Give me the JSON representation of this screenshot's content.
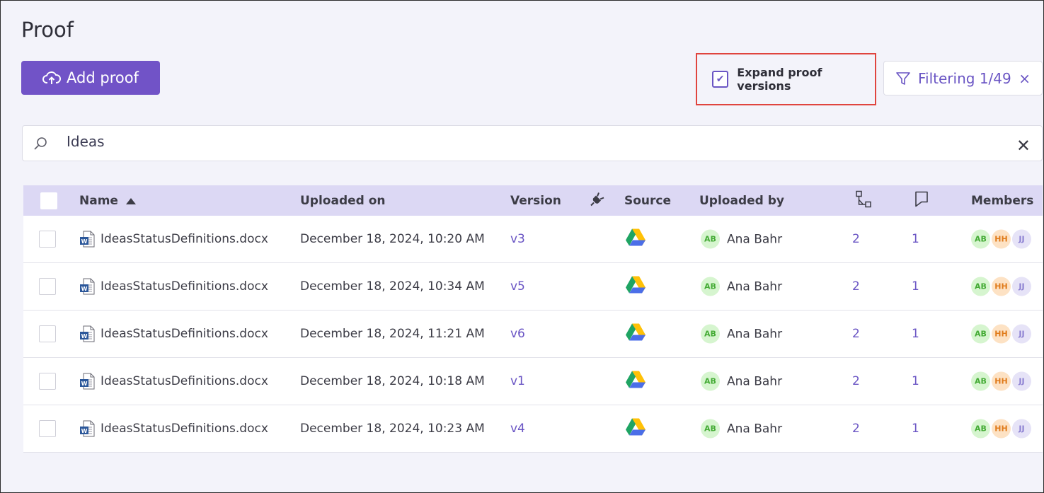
{
  "page": {
    "title": "Proof"
  },
  "toolbar": {
    "add_label": "Add proof",
    "expand_label": "Expand proof versions",
    "expand_checked": true,
    "filter_label": "Filtering 1/49"
  },
  "search": {
    "value": "Ideas"
  },
  "table": {
    "headers": {
      "name": "Name",
      "uploaded_on": "Uploaded on",
      "version": "Version",
      "source": "Source",
      "uploaded_by": "Uploaded by",
      "members": "Members"
    },
    "sort": {
      "column": "name",
      "direction": "ascending"
    },
    "rows": [
      {
        "name": "IdeasStatusDefinitions.docx",
        "uploaded_on": "December 18, 2024, 10:20 AM",
        "version": "v3",
        "uploader_initials": "AB",
        "uploader": "Ana Bahr",
        "workflow_count": "2",
        "comments_count": "1",
        "members": [
          "AB",
          "HH",
          "JJ"
        ]
      },
      {
        "name": "IdeasStatusDefinitions.docx",
        "uploaded_on": "December 18, 2024, 10:34 AM",
        "version": "v5",
        "uploader_initials": "AB",
        "uploader": "Ana Bahr",
        "workflow_count": "2",
        "comments_count": "1",
        "members": [
          "AB",
          "HH",
          "JJ"
        ]
      },
      {
        "name": "IdeasStatusDefinitions.docx",
        "uploaded_on": "December 18, 2024, 11:21 AM",
        "version": "v6",
        "uploader_initials": "AB",
        "uploader": "Ana Bahr",
        "workflow_count": "2",
        "comments_count": "1",
        "members": [
          "AB",
          "HH",
          "JJ"
        ]
      },
      {
        "name": "IdeasStatusDefinitions.docx",
        "uploaded_on": "December 18, 2024, 10:18 AM",
        "version": "v1",
        "uploader_initials": "AB",
        "uploader": "Ana Bahr",
        "workflow_count": "2",
        "comments_count": "1",
        "members": [
          "AB",
          "HH",
          "JJ"
        ]
      },
      {
        "name": "IdeasStatusDefinitions.docx",
        "uploaded_on": "December 18, 2024, 10:23 AM",
        "version": "v4",
        "uploader_initials": "AB",
        "uploader": "Ana Bahr",
        "workflow_count": "2",
        "comments_count": "1",
        "members": [
          "AB",
          "HH",
          "JJ"
        ]
      }
    ]
  },
  "icons": {
    "add": "cloud-upload-icon",
    "filter": "filter-icon",
    "search": "search-icon",
    "clear": "close-icon",
    "plugin": "plug-icon",
    "workflow": "workflow-icon",
    "comments": "comment-flag-icon",
    "file": "word-document-icon",
    "source": "google-drive-icon"
  },
  "colors": {
    "accent": "#7153c7",
    "header_bg": "#dcd8f4",
    "highlight": "#e0443e"
  }
}
